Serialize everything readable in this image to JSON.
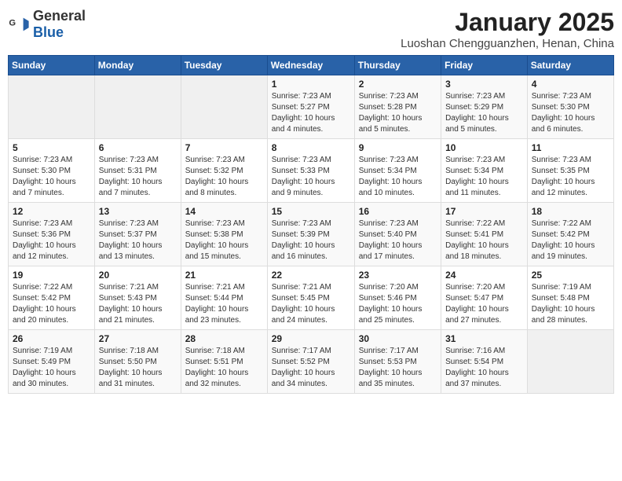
{
  "header": {
    "logo_general": "General",
    "logo_blue": "Blue",
    "month_title": "January 2025",
    "location": "Luoshan Chengguanzhen, Henan, China"
  },
  "weekdays": [
    "Sunday",
    "Monday",
    "Tuesday",
    "Wednesday",
    "Thursday",
    "Friday",
    "Saturday"
  ],
  "weeks": [
    [
      {
        "day": "",
        "info": ""
      },
      {
        "day": "",
        "info": ""
      },
      {
        "day": "",
        "info": ""
      },
      {
        "day": "1",
        "info": "Sunrise: 7:23 AM\nSunset: 5:27 PM\nDaylight: 10 hours\nand 4 minutes."
      },
      {
        "day": "2",
        "info": "Sunrise: 7:23 AM\nSunset: 5:28 PM\nDaylight: 10 hours\nand 5 minutes."
      },
      {
        "day": "3",
        "info": "Sunrise: 7:23 AM\nSunset: 5:29 PM\nDaylight: 10 hours\nand 5 minutes."
      },
      {
        "day": "4",
        "info": "Sunrise: 7:23 AM\nSunset: 5:30 PM\nDaylight: 10 hours\nand 6 minutes."
      }
    ],
    [
      {
        "day": "5",
        "info": "Sunrise: 7:23 AM\nSunset: 5:30 PM\nDaylight: 10 hours\nand 7 minutes."
      },
      {
        "day": "6",
        "info": "Sunrise: 7:23 AM\nSunset: 5:31 PM\nDaylight: 10 hours\nand 7 minutes."
      },
      {
        "day": "7",
        "info": "Sunrise: 7:23 AM\nSunset: 5:32 PM\nDaylight: 10 hours\nand 8 minutes."
      },
      {
        "day": "8",
        "info": "Sunrise: 7:23 AM\nSunset: 5:33 PM\nDaylight: 10 hours\nand 9 minutes."
      },
      {
        "day": "9",
        "info": "Sunrise: 7:23 AM\nSunset: 5:34 PM\nDaylight: 10 hours\nand 10 minutes."
      },
      {
        "day": "10",
        "info": "Sunrise: 7:23 AM\nSunset: 5:34 PM\nDaylight: 10 hours\nand 11 minutes."
      },
      {
        "day": "11",
        "info": "Sunrise: 7:23 AM\nSunset: 5:35 PM\nDaylight: 10 hours\nand 12 minutes."
      }
    ],
    [
      {
        "day": "12",
        "info": "Sunrise: 7:23 AM\nSunset: 5:36 PM\nDaylight: 10 hours\nand 12 minutes."
      },
      {
        "day": "13",
        "info": "Sunrise: 7:23 AM\nSunset: 5:37 PM\nDaylight: 10 hours\nand 13 minutes."
      },
      {
        "day": "14",
        "info": "Sunrise: 7:23 AM\nSunset: 5:38 PM\nDaylight: 10 hours\nand 15 minutes."
      },
      {
        "day": "15",
        "info": "Sunrise: 7:23 AM\nSunset: 5:39 PM\nDaylight: 10 hours\nand 16 minutes."
      },
      {
        "day": "16",
        "info": "Sunrise: 7:23 AM\nSunset: 5:40 PM\nDaylight: 10 hours\nand 17 minutes."
      },
      {
        "day": "17",
        "info": "Sunrise: 7:22 AM\nSunset: 5:41 PM\nDaylight: 10 hours\nand 18 minutes."
      },
      {
        "day": "18",
        "info": "Sunrise: 7:22 AM\nSunset: 5:42 PM\nDaylight: 10 hours\nand 19 minutes."
      }
    ],
    [
      {
        "day": "19",
        "info": "Sunrise: 7:22 AM\nSunset: 5:42 PM\nDaylight: 10 hours\nand 20 minutes."
      },
      {
        "day": "20",
        "info": "Sunrise: 7:21 AM\nSunset: 5:43 PM\nDaylight: 10 hours\nand 21 minutes."
      },
      {
        "day": "21",
        "info": "Sunrise: 7:21 AM\nSunset: 5:44 PM\nDaylight: 10 hours\nand 23 minutes."
      },
      {
        "day": "22",
        "info": "Sunrise: 7:21 AM\nSunset: 5:45 PM\nDaylight: 10 hours\nand 24 minutes."
      },
      {
        "day": "23",
        "info": "Sunrise: 7:20 AM\nSunset: 5:46 PM\nDaylight: 10 hours\nand 25 minutes."
      },
      {
        "day": "24",
        "info": "Sunrise: 7:20 AM\nSunset: 5:47 PM\nDaylight: 10 hours\nand 27 minutes."
      },
      {
        "day": "25",
        "info": "Sunrise: 7:19 AM\nSunset: 5:48 PM\nDaylight: 10 hours\nand 28 minutes."
      }
    ],
    [
      {
        "day": "26",
        "info": "Sunrise: 7:19 AM\nSunset: 5:49 PM\nDaylight: 10 hours\nand 30 minutes."
      },
      {
        "day": "27",
        "info": "Sunrise: 7:18 AM\nSunset: 5:50 PM\nDaylight: 10 hours\nand 31 minutes."
      },
      {
        "day": "28",
        "info": "Sunrise: 7:18 AM\nSunset: 5:51 PM\nDaylight: 10 hours\nand 32 minutes."
      },
      {
        "day": "29",
        "info": "Sunrise: 7:17 AM\nSunset: 5:52 PM\nDaylight: 10 hours\nand 34 minutes."
      },
      {
        "day": "30",
        "info": "Sunrise: 7:17 AM\nSunset: 5:53 PM\nDaylight: 10 hours\nand 35 minutes."
      },
      {
        "day": "31",
        "info": "Sunrise: 7:16 AM\nSunset: 5:54 PM\nDaylight: 10 hours\nand 37 minutes."
      },
      {
        "day": "",
        "info": ""
      }
    ]
  ]
}
